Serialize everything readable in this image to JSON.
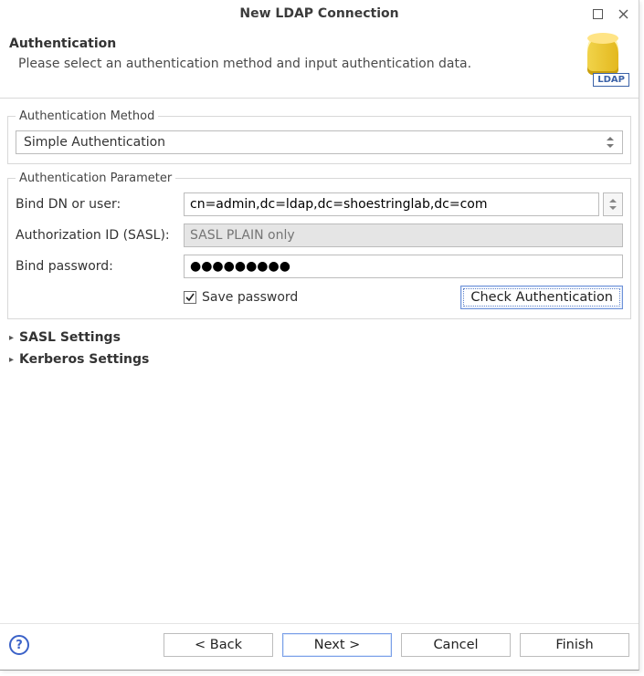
{
  "titlebar": {
    "title": "New LDAP Connection"
  },
  "banner": {
    "heading": "Authentication",
    "description": "Please select an authentication method and input authentication data.",
    "icon_name": "ldap-cylinder-icon",
    "icon_badge": "LDAP"
  },
  "auth_method": {
    "legend": "Authentication Method",
    "selected": "Simple Authentication"
  },
  "auth_param": {
    "legend": "Authentication Parameter",
    "bind_dn_label": "Bind DN or user:",
    "bind_dn_value": "cn=admin,dc=ldap,dc=shoestringlab,dc=com",
    "authz_id_label": "Authorization ID (SASL):",
    "authz_id_placeholder": "SASL PLAIN only",
    "bind_pw_label": "Bind password:",
    "bind_pw_value": "●●●●●●●●●",
    "save_pw_label": "Save password",
    "save_pw_checked": true,
    "check_auth_label": "Check Authentication"
  },
  "sections": {
    "sasl": "SASL Settings",
    "kerberos": "Kerberos Settings"
  },
  "footer": {
    "back": "< Back",
    "next": "Next >",
    "cancel": "Cancel",
    "finish": "Finish"
  }
}
